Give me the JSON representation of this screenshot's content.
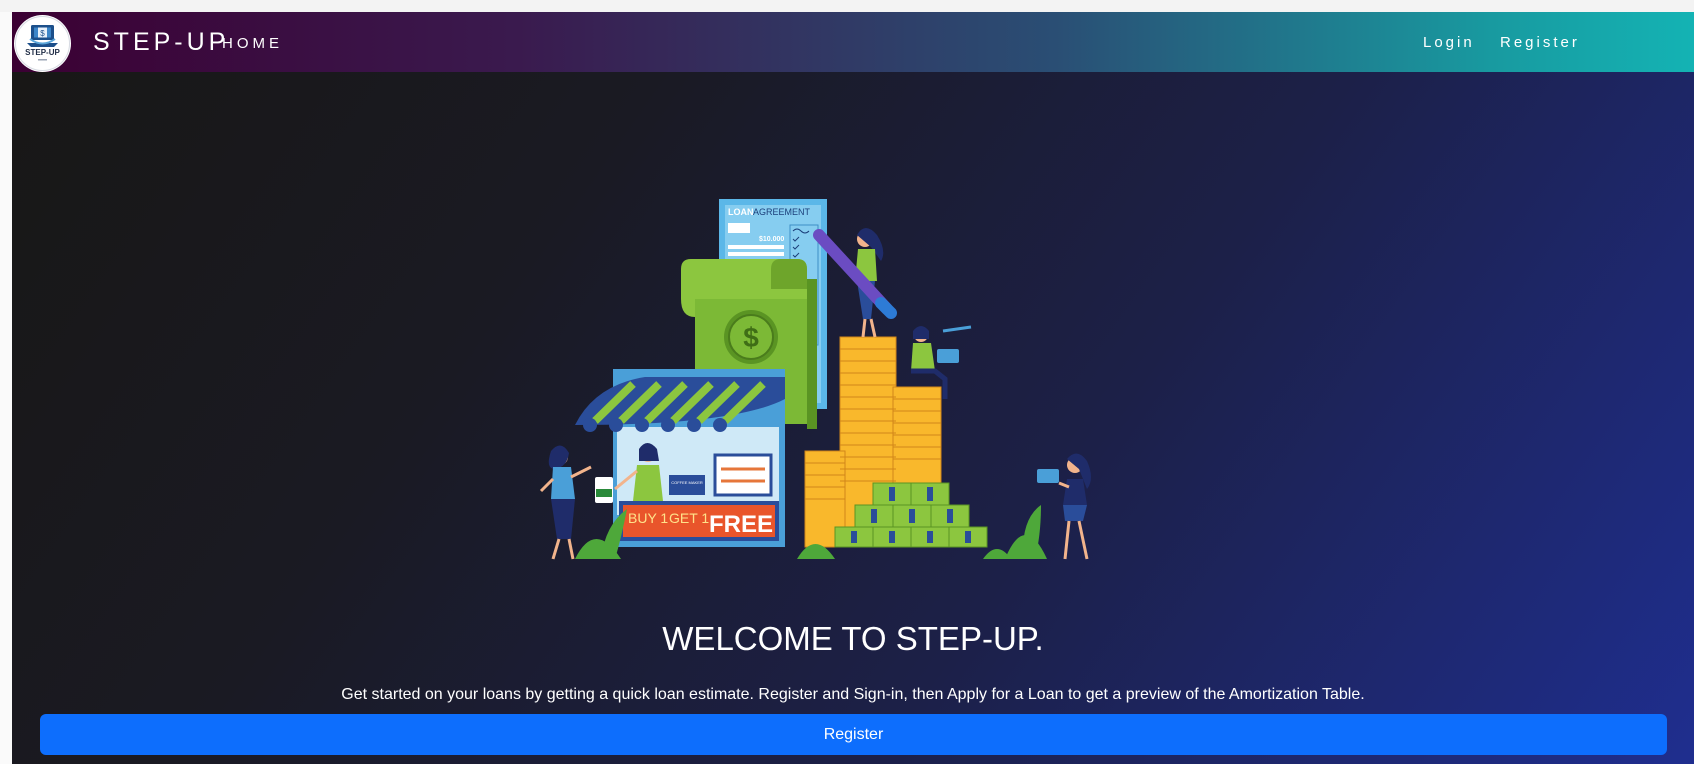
{
  "navbar": {
    "brand": "STEP-UP",
    "home_label": "HOME",
    "links": {
      "login": "Login",
      "register": "Register"
    }
  },
  "logo": {
    "icon": "dollar-monitor-logo",
    "text": "STEP-UP"
  },
  "illustration": {
    "icon": "loan-market-illustration",
    "document_title_bold": "LOAN",
    "document_title_rest": "AGREEMENT",
    "document_amount": "$10.000",
    "banner_buy": "BUY 1",
    "banner_get": "GET 1",
    "banner_free": "FREE",
    "sign_text": "COFFEE MAKER"
  },
  "hero": {
    "title": "WELCOME TO STEP-UP.",
    "subtitle": "Get started on your loans by getting a quick loan estimate. Register and Sign-in, then Apply for a Loan to get a preview of the Amortization Table.",
    "register_button": "Register"
  },
  "colors": {
    "primary_button": "#0d6efd",
    "navbar_start": "#3b0033",
    "navbar_end": "#14b3b4",
    "hero_dark": "#181716",
    "hero_blue": "#1f2e8f"
  }
}
